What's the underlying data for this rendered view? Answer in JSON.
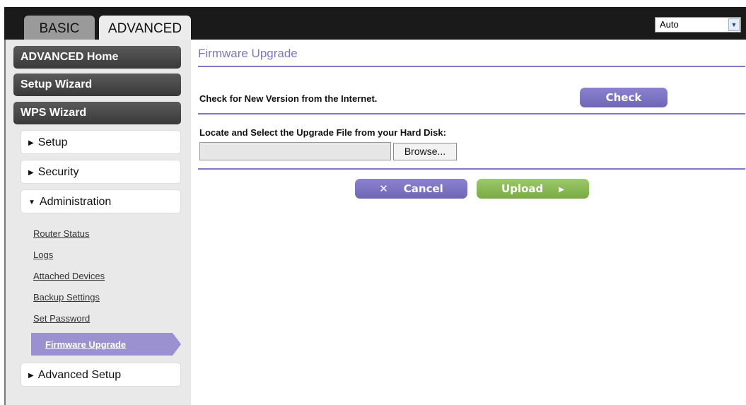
{
  "tabs": {
    "basic": "BASIC",
    "advanced": "ADVANCED"
  },
  "language_select": {
    "value": "Auto"
  },
  "sidebar": {
    "primary": [
      "ADVANCED Home",
      "Setup Wizard",
      "WPS Wizard"
    ],
    "sections": [
      "Setup",
      "Security",
      "Administration",
      "Advanced Setup"
    ],
    "admin_links": [
      "Router Status",
      "Logs",
      "Attached Devices",
      "Backup Settings",
      "Set Password",
      "Firmware Upgrade"
    ]
  },
  "main": {
    "title": "Firmware Upgrade",
    "check_label": "Check for New Version from the Internet.",
    "check_button": "Check",
    "locate_label": "Locate and Select the Upgrade File from your Hard Disk:",
    "file_value": "",
    "browse_button": "Browse...",
    "cancel_button": "Cancel",
    "upload_button": "Upload"
  },
  "colors": {
    "accent_purple": "#7f77c6",
    "upload_green": "#8bbd55",
    "sidebar_dark": "#444444"
  }
}
